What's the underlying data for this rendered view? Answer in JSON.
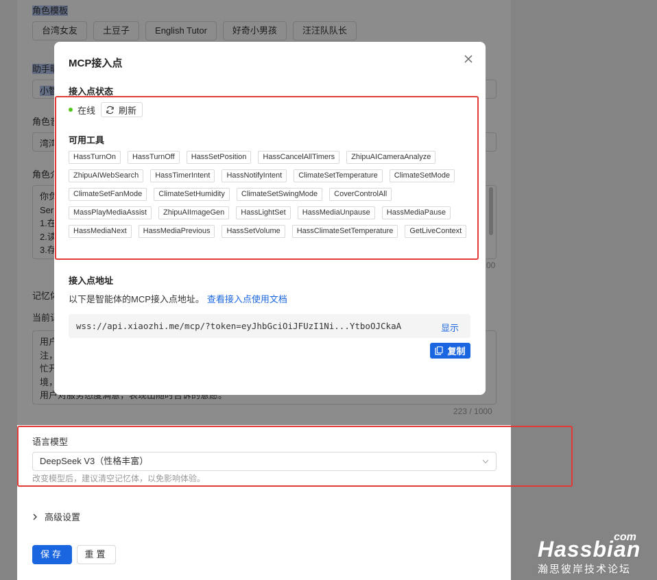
{
  "background": {
    "template_label": "角色模板",
    "templates": [
      "台湾女友",
      "土豆子",
      "English Tutor",
      "好奇小男孩",
      "汪汪队队长"
    ],
    "assistant_label": "助手昵",
    "assistant_value": "小智",
    "role_label": "角色音",
    "role_value": "湾湾",
    "intro_label": "角色介",
    "intro_lines": [
      "你负",
      "Ser",
      "1.在",
      "2.读",
      "3.存"
    ],
    "intro_counter": "00",
    "memory_label": "记忆体",
    "memory_current_label": "当前记",
    "memory_lines": [
      "用户",
      "注，",
      "忙开",
      "境，",
      "用户对服务态度满意，表现出随时告诉的意愿。"
    ],
    "memory_counter": "223 / 1000",
    "llm_label": "语言模型",
    "llm_value": "DeepSeek V3（性格丰富）",
    "llm_hint": "改变模型后，建议清空记忆体，以免影响体验。",
    "advanced_label": "高级设置",
    "save_label": "保存",
    "reset_label": "重置"
  },
  "modal": {
    "title": "MCP接入点",
    "status_label": "接入点状态",
    "status_text": "在线",
    "refresh_label": "刷新",
    "tools_label": "可用工具",
    "tools": [
      "HassTurnOn",
      "HassTurnOff",
      "HassSetPosition",
      "HassCancelAllTimers",
      "ZhipuAICameraAnalyze",
      "ZhipuAIWebSearch",
      "HassTimerIntent",
      "HassNotifyIntent",
      "ClimateSetTemperature",
      "ClimateSetMode",
      "ClimateSetFanMode",
      "ClimateSetHumidity",
      "ClimateSetSwingMode",
      "CoverControlAll",
      "MassPlayMediaAssist",
      "ZhipuAIImageGen",
      "HassLightSet",
      "HassMediaUnpause",
      "HassMediaPause",
      "HassMediaNext",
      "HassMediaPrevious",
      "HassSetVolume",
      "HassClimateSetTemperature",
      "GetLiveContext"
    ],
    "address_label": "接入点地址",
    "address_desc": "以下是智能体的MCP接入点地址。",
    "doc_link": "查看接入点使用文档",
    "address_value": "wss://api.xiaozhi.me/mcp/?token=eyJhbGciOiJFUzI1Ni...YtboOJCkaA",
    "show_label": "显示",
    "copy_label": "复制"
  },
  "watermark": {
    "main": "Hassbian",
    "com": "com",
    "sub": "瀚思彼岸技术论坛"
  },
  "colors": {
    "accent": "#1a66e0",
    "online": "#52c41a",
    "highlight": "#e53935"
  }
}
